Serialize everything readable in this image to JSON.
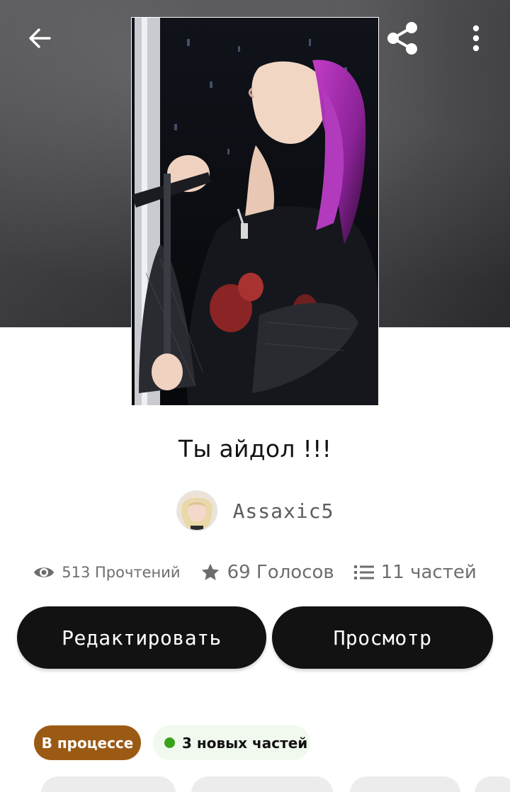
{
  "header": {
    "back_icon": "arrow-left-icon",
    "share_icon": "share-icon",
    "more_icon": "more-vertical-icon"
  },
  "story": {
    "title": "Ты айдол !!!",
    "author": "Assaxic5"
  },
  "stats": {
    "reads": "513 Прочтений",
    "votes": "69 Голосов",
    "parts": "11 частей"
  },
  "actions": {
    "edit_label": "Редактировать",
    "view_label": "Просмотр"
  },
  "badges": {
    "status_label": "В процессе",
    "status_color": "#9b5a14",
    "new_parts_label": "3 новых частей",
    "new_parts_dot_color": "#3aa21a"
  }
}
